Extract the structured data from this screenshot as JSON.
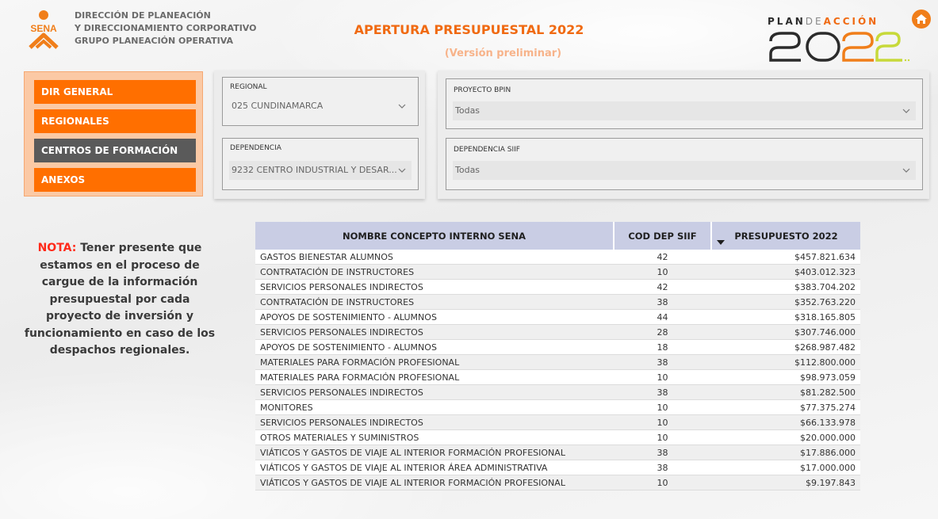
{
  "header": {
    "logo_text": "SENA",
    "org_lines": [
      "DIRECCIÓN DE PLANEACIÓN",
      "Y DIRECCIONAMIENTO CORPORATIVO",
      "GRUPO PLANEACIÓN OPERATIVA"
    ],
    "title": "APERTURA PRESUPUESTAL 2022",
    "subtitle": "(Versión preliminar)",
    "plan_logo": {
      "plan": "PLAN",
      "de": "DE",
      "accion": "ACCIÓN",
      "year": "2022"
    },
    "home_icon": "home-icon"
  },
  "nav": {
    "items": [
      {
        "label": "DIR GENERAL",
        "active": false
      },
      {
        "label": "REGIONALES",
        "active": false
      },
      {
        "label": "CENTROS DE FORMACIÓN",
        "active": true
      },
      {
        "label": "ANEXOS",
        "active": false
      }
    ]
  },
  "filters": {
    "regional": {
      "label": "REGIONAL",
      "value": "025 CUNDINAMARCA"
    },
    "dependencia": {
      "label": "DEPENDENCIA",
      "value": "9232 CENTRO INDUSTRIAL Y DESAR..."
    },
    "proyecto_bpin": {
      "label": "PROYECTO BPIN",
      "value": "Todas"
    },
    "dependencia_siif": {
      "label": "DEPENDENCIA SIIF",
      "value": "Todas"
    }
  },
  "note": {
    "label": "NOTA:",
    "text": "Tener presente que estamos en el proceso de cargue de la información presupuestal por cada proyecto de inversión y funcionamiento en caso de los despachos regionales."
  },
  "table": {
    "columns": [
      "NOMBRE CONCEPTO INTERNO SENA",
      "COD DEP SIIF",
      "PRESUPUESTO 2022"
    ],
    "sorted_column": "PRESUPUESTO 2022",
    "sort_direction": "descending",
    "rows": [
      [
        "GASTOS BIENESTAR ALUMNOS",
        "42",
        "$457.821.634"
      ],
      [
        "CONTRATACIÓN DE INSTRUCTORES",
        "10",
        "$403.012.323"
      ],
      [
        "SERVICIOS PERSONALES INDIRECTOS",
        "42",
        "$383.704.202"
      ],
      [
        "CONTRATACIÓN DE INSTRUCTORES",
        "38",
        "$352.763.220"
      ],
      [
        "APOYOS DE SOSTENIMIENTO - ALUMNOS",
        "44",
        "$318.165.805"
      ],
      [
        "SERVICIOS PERSONALES INDIRECTOS",
        "28",
        "$307.746.000"
      ],
      [
        "APOYOS DE SOSTENIMIENTO - ALUMNOS",
        "18",
        "$268.987.482"
      ],
      [
        "MATERIALES PARA FORMACIÓN PROFESIONAL",
        "38",
        "$112.800.000"
      ],
      [
        "MATERIALES PARA FORMACIÓN PROFESIONAL",
        "10",
        "$98.973.059"
      ],
      [
        "SERVICIOS PERSONALES INDIRECTOS",
        "38",
        "$81.282.500"
      ],
      [
        "MONITORES",
        "10",
        "$77.375.274"
      ],
      [
        "SERVICIOS PERSONALES INDIRECTOS",
        "10",
        "$66.133.978"
      ],
      [
        "OTROS MATERIALES Y SUMINISTROS",
        "10",
        "$20.000.000"
      ],
      [
        "VIÁTICOS Y GASTOS DE VIAJE AL INTERIOR FORMACIÓN PROFESIONAL",
        "38",
        "$17.886.000"
      ],
      [
        "VIÁTICOS Y GASTOS DE VIAJE AL INTERIOR ÁREA ADMINISTRATIVA",
        "38",
        "$17.000.000"
      ],
      [
        "VIÁTICOS Y GASTOS DE VIAJE AL INTERIOR FORMACIÓN PROFESIONAL",
        "10",
        "$9.197.843"
      ]
    ]
  },
  "colors": {
    "accent_orange": "#ff6f00",
    "title_orange": "#f06a12",
    "active_nav": "#5a5a5a",
    "table_header": "#c9cde4",
    "note_label": "#ff2a1a"
  }
}
